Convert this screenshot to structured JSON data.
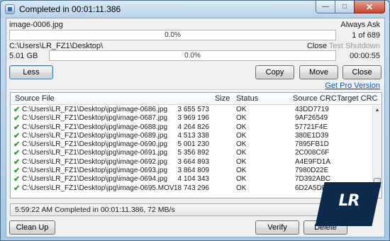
{
  "window": {
    "title": "Completed in 00:01:11.386",
    "min_glyph": "—",
    "max_glyph": "□",
    "close_glyph": "✕"
  },
  "file_section": {
    "current_file": "image-0006.jpg",
    "overwrite_mode": "Always Ask",
    "file_progress_text": "0.0%",
    "file_progress_value": 0.0,
    "file_count": "1 of 689"
  },
  "path_section": {
    "path": "C:\\Users\\LR_FZ1\\Desktop\\",
    "close_link": "Close",
    "test_link": "Test",
    "shutdown_link": "Shutdown",
    "size": "5.01 GB",
    "total_progress_text": "0.0%",
    "total_progress_value": 0.0,
    "time_remaining": "00:00:55"
  },
  "buttons": {
    "less": "Less",
    "copy": "Copy",
    "move": "Move",
    "close": "Close",
    "get_pro": "Get Pro Version",
    "clean_up": "Clean Up",
    "verify": "Verify",
    "delete": "Delete"
  },
  "table": {
    "columns": [
      "Source File",
      "Size",
      "Status",
      "Source CRC",
      "Target CRC"
    ],
    "rows": [
      {
        "file": "C:\\Users\\LR_FZ1\\Desktop\\jpg\\image-0686.jpg",
        "size": "3 655 573",
        "status": "OK",
        "crc": "43DD7719",
        "target": ""
      },
      {
        "file": "C:\\Users\\LR_FZ1\\Desktop\\jpg\\image-0687.jpg",
        "size": "3 969 196",
        "status": "OK",
        "crc": "9AF26549",
        "target": ""
      },
      {
        "file": "C:\\Users\\LR_FZ1\\Desktop\\jpg\\image-0688.jpg",
        "size": "4 264 826",
        "status": "OK",
        "crc": "57721F4E",
        "target": ""
      },
      {
        "file": "C:\\Users\\LR_FZ1\\Desktop\\jpg\\image-0689.jpg",
        "size": "4 513 338",
        "status": "OK",
        "crc": "380E1D39",
        "target": ""
      },
      {
        "file": "C:\\Users\\LR_FZ1\\Desktop\\jpg\\image-0690.jpg",
        "size": "5 001 230",
        "status": "OK",
        "crc": "7895FB1D",
        "target": ""
      },
      {
        "file": "C:\\Users\\LR_FZ1\\Desktop\\jpg\\image-0691.jpg",
        "size": "5 356 892",
        "status": "OK",
        "crc": "2C008C6F",
        "target": ""
      },
      {
        "file": "C:\\Users\\LR_FZ1\\Desktop\\jpg\\image-0692.jpg",
        "size": "3 664 893",
        "status": "OK",
        "crc": "A4E9FD1A",
        "target": ""
      },
      {
        "file": "C:\\Users\\LR_FZ1\\Desktop\\jpg\\image-0693.jpg",
        "size": "3 864 809",
        "status": "OK",
        "crc": "7980D22E",
        "target": ""
      },
      {
        "file": "C:\\Users\\LR_FZ1\\Desktop\\jpg\\image-0694.jpg",
        "size": "4 104 343",
        "status": "OK",
        "crc": "7D392ABC",
        "target": ""
      },
      {
        "file": "C:\\Users\\LR_FZ1\\Desktop\\jpg\\image-0695.MOV",
        "size": "18 743 296",
        "status": "OK",
        "crc": "6D2A5DF7",
        "target": ""
      }
    ]
  },
  "status_bar": {
    "text": "5:59:22 AM Completed in 00:01:11.386, 72 MB/s"
  },
  "icons": {
    "check": "✔",
    "scroll_up": "▲",
    "scroll_down": "▼"
  },
  "watermark": {
    "text": "LR"
  },
  "colors": {
    "accent": "#0a5bb5",
    "check": "#2aa02a",
    "close_button": "#c6452c"
  }
}
